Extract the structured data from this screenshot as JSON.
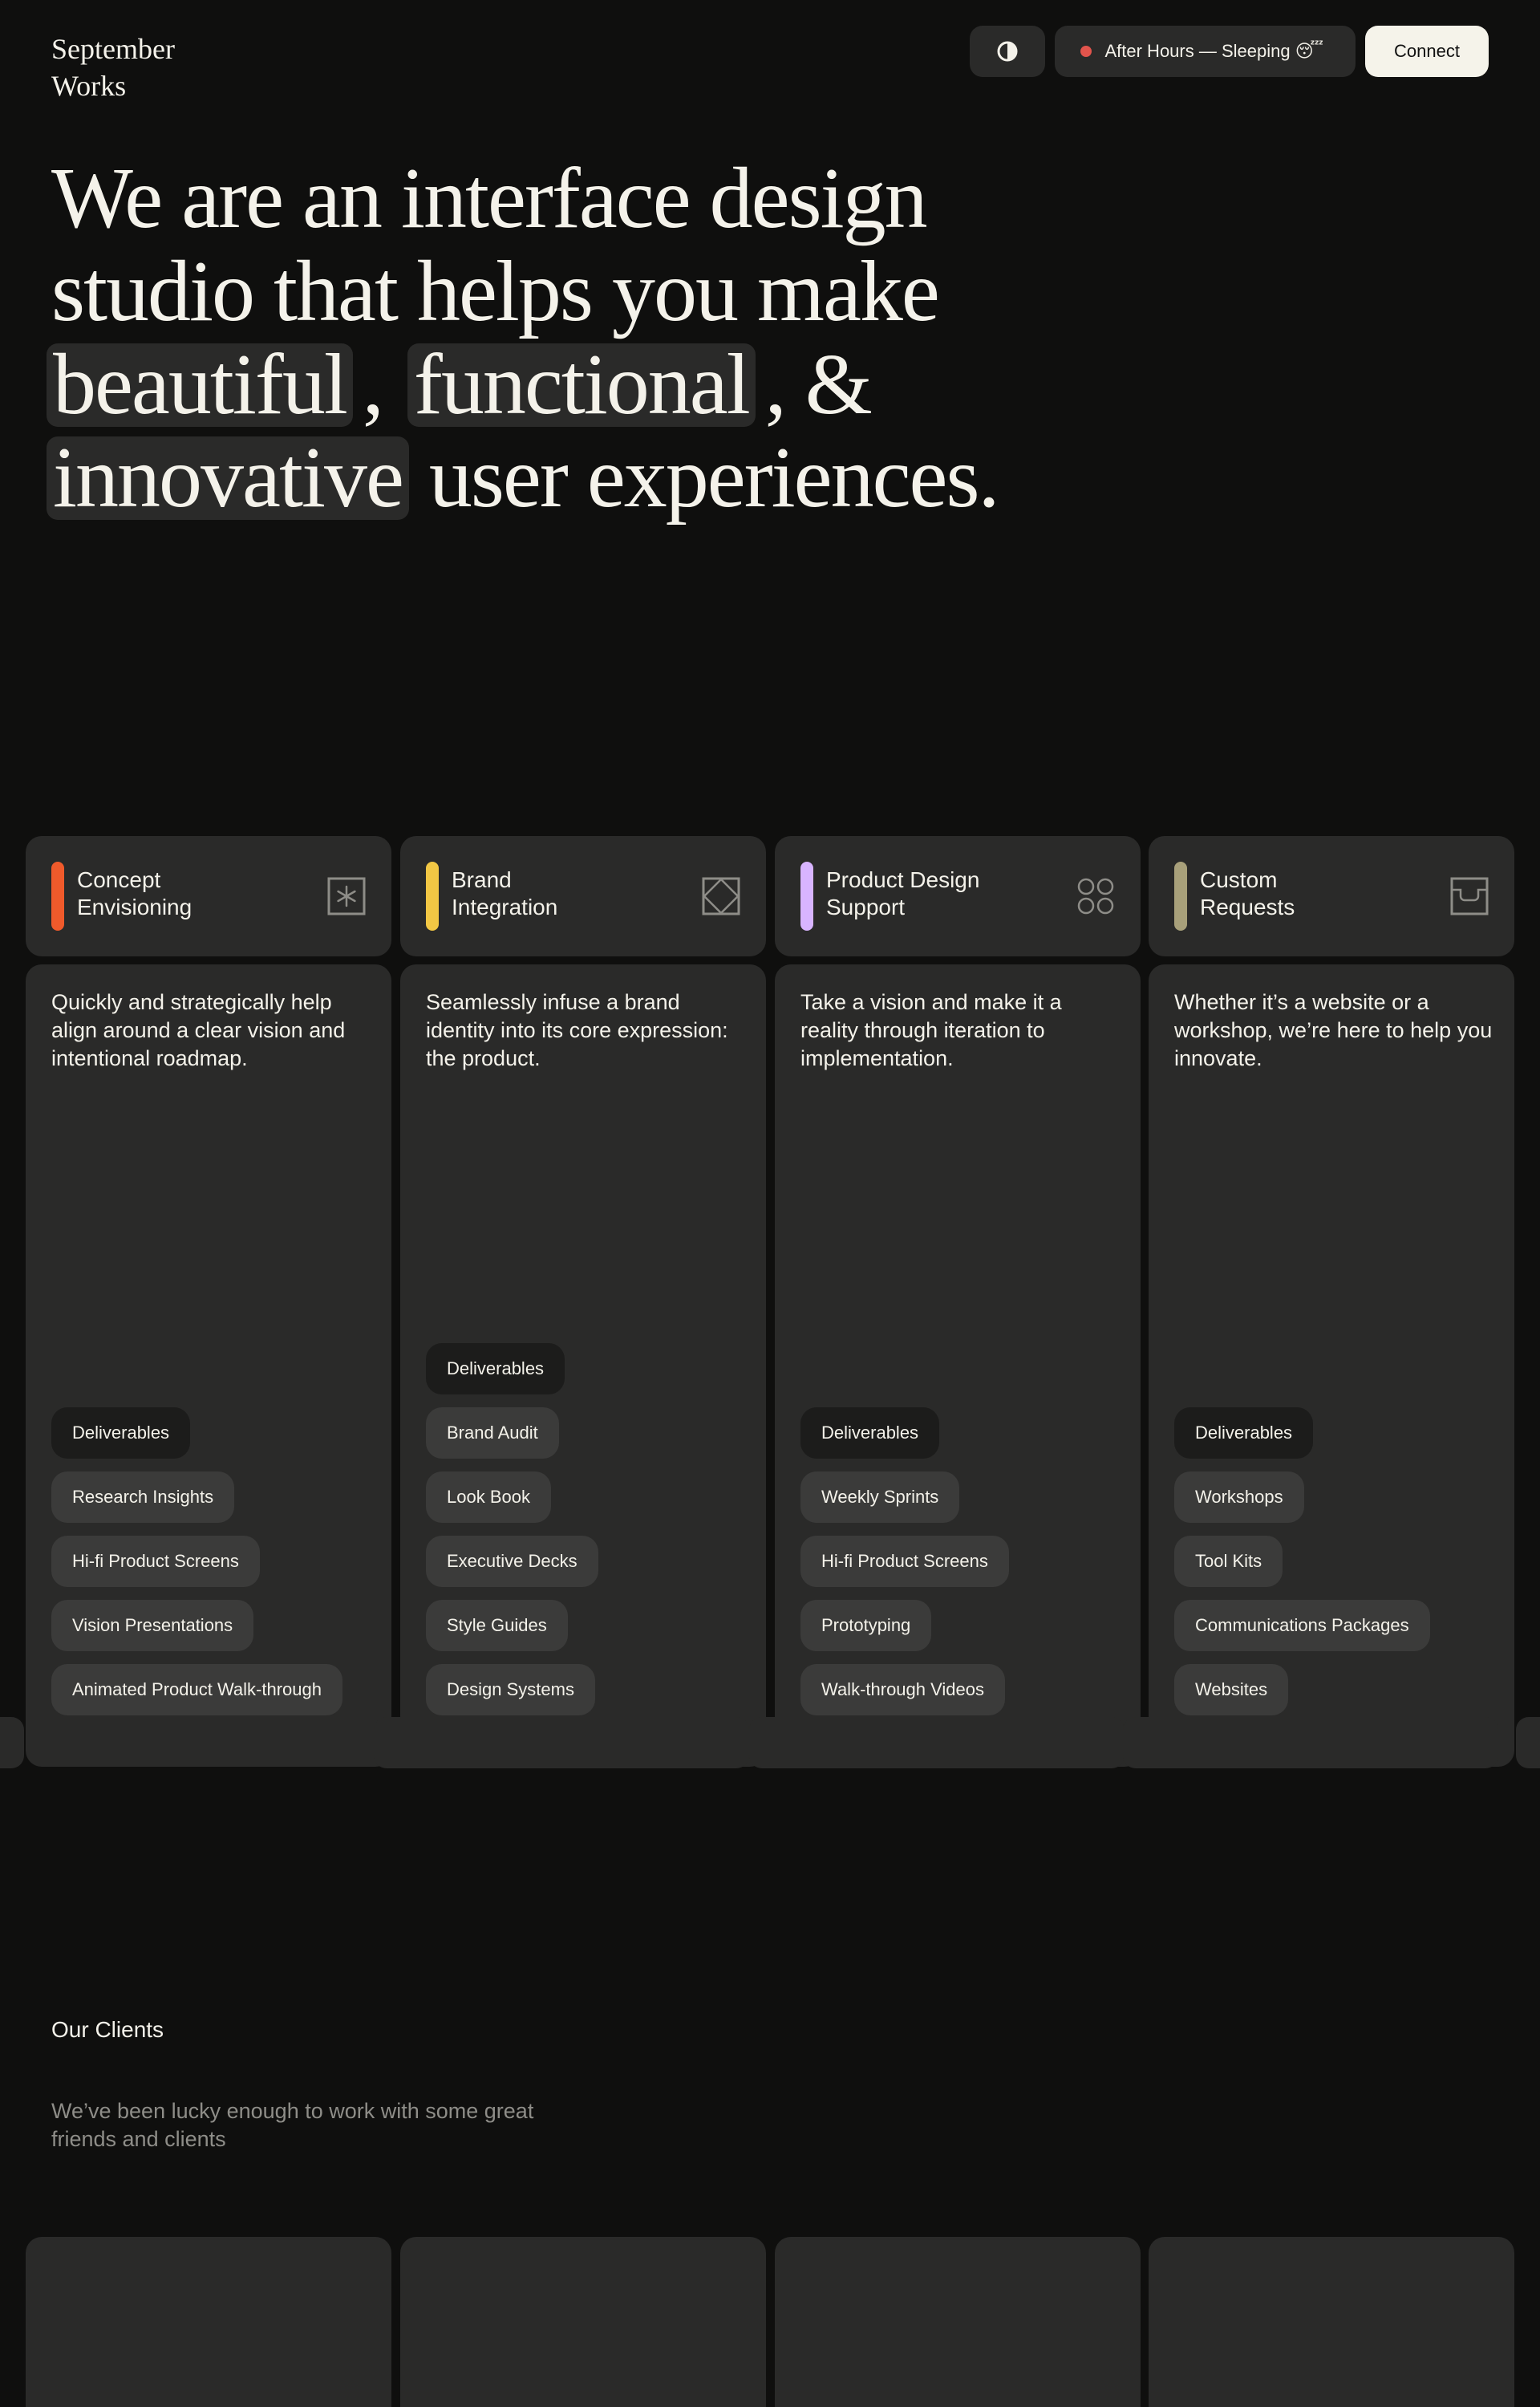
{
  "header": {
    "logo": "September\nWorks",
    "theme_toggle_icon": "contrast-icon",
    "status_text": "After Hours — Sleeping 😴",
    "status_color": "#e2544c",
    "connect_label": "Connect"
  },
  "hero": {
    "line1": "We are an interface design",
    "line2": "studio that helps you make",
    "word1": "beautiful",
    "sep1": ",",
    "word2": "functional",
    "sep2": ", &",
    "word3": "innovative",
    "tail": "user experiences."
  },
  "services": [
    {
      "title": "Concept\nEnvisioning",
      "accent": "#f05a2b",
      "icon": "asterisk-box-icon",
      "description": "Quickly and strategically help align around a clear vision and intentional roadmap.",
      "tags": [
        "Deliverables",
        "Research Insights",
        "Hi-fi Product Screens",
        "Vision Presentations",
        "Animated Product Walk-through"
      ]
    },
    {
      "title": "Brand\nIntegration",
      "accent": "#f2c744",
      "icon": "diamond-box-icon",
      "description": "Seamlessly infuse a brand identity into its core expression: the product.",
      "tags": [
        "Deliverables",
        "Brand Audit",
        "Look Book",
        "Executive Decks",
        "Style Guides",
        "Design Systems"
      ]
    },
    {
      "title": "Product Design\nSupport",
      "accent": "#d8b4ff",
      "icon": "four-circles-icon",
      "description": "Take a vision and make it a reality through iteration to implementation.",
      "tags": [
        "Deliverables",
        "Weekly Sprints",
        "Hi-fi Product Screens",
        "Prototyping",
        "Walk-through Videos"
      ]
    },
    {
      "title": "Custom\nRequests",
      "accent": "#a8a07a",
      "icon": "tray-icon",
      "description": "Whether it’s a website or a workshop, we’re here to help you innovate.",
      "tags": [
        "Deliverables",
        "Workshops",
        "Tool Kits",
        "Communications Packages",
        "Websites"
      ]
    }
  ],
  "clients": {
    "title": "Our Clients",
    "subtitle": "We’ve been lucky enough to work with some great friends and clients"
  }
}
